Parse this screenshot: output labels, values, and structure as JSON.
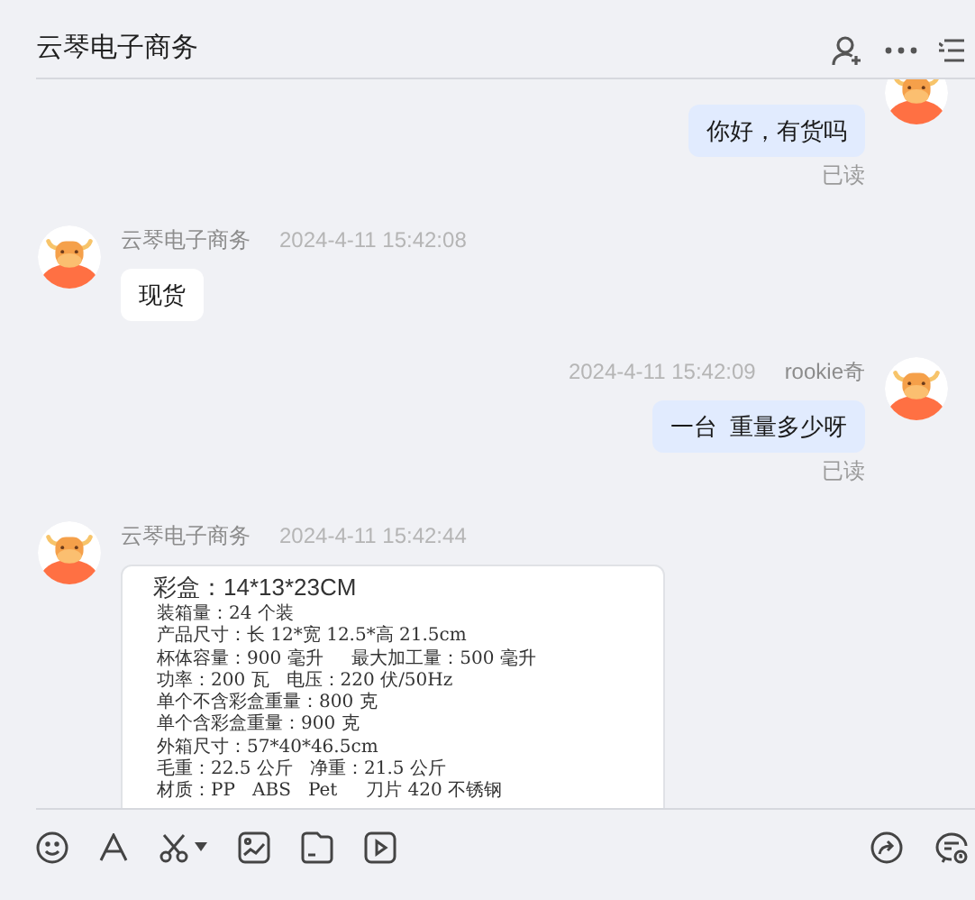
{
  "header": {
    "title": "云琴电子商务"
  },
  "messages": [
    {
      "outgoing": true,
      "kind": "text",
      "text": "你好，有货吗",
      "status": "已读"
    },
    {
      "outgoing": false,
      "kind": "text",
      "sender": "云琴电子商务",
      "time": "2024-4-11 15:42:08",
      "text": "现货"
    },
    {
      "outgoing": true,
      "kind": "text",
      "sender": "rookie奇",
      "time": "2024-4-11 15:42:09",
      "text": "一台  重量多少呀",
      "status": "已读"
    },
    {
      "outgoing": false,
      "kind": "document",
      "sender": "云琴电子商务",
      "time": "2024-4-11 15:42:44",
      "title": "彩盒：14*13*23CM",
      "lines": [
        "装箱量：24 个装",
        "产品尺寸：长 12*宽 12.5*高 21.5cm",
        "杯体容量：900 毫升     最大加工量：500 毫升",
        "功率：200 瓦   电压：220 伏/50Hz",
        "单个不含彩盒重量：800 克",
        "单个含彩盒重量：900 克",
        "外箱尺寸：57*40*46.5cm",
        "毛重：22.5 公斤   净重：21.5 公斤",
        "材质：PP   ABS   Pet     刀片 420 不锈钢"
      ]
    }
  ]
}
